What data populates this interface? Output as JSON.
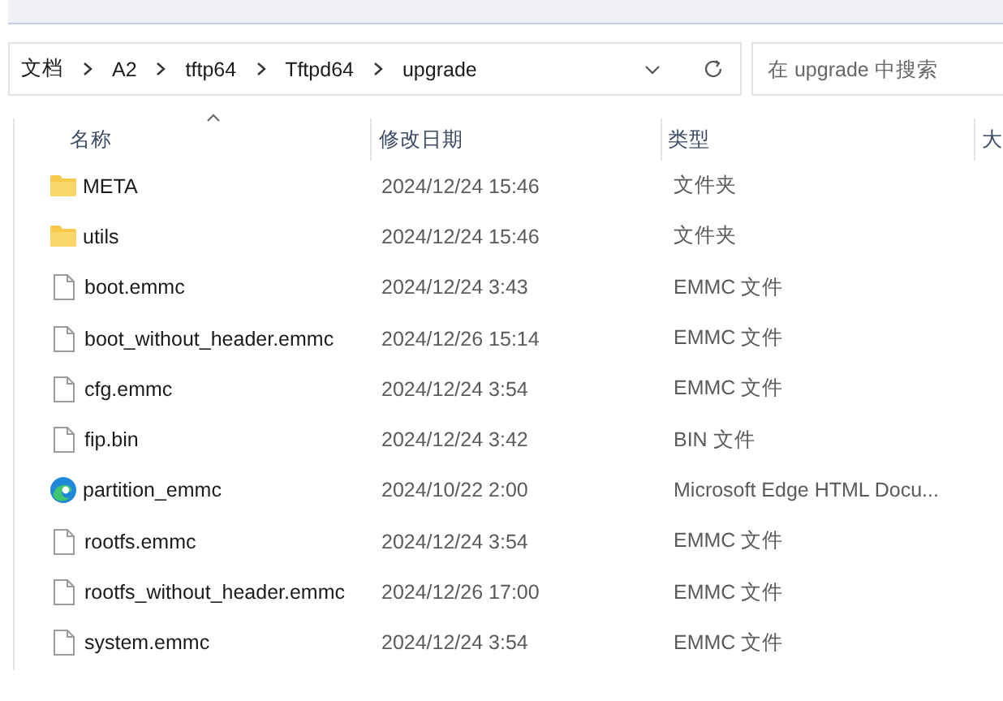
{
  "address_bar": {
    "path": [
      "文档",
      "A2",
      "tftp64",
      "Tftpd64",
      "upgrade"
    ]
  },
  "search": {
    "placeholder": "在 upgrade 中搜索"
  },
  "table": {
    "columns": [
      {
        "label": "名称",
        "sorted": true
      },
      {
        "label": "修改日期",
        "sorted": false
      },
      {
        "label": "类型",
        "sorted": false
      },
      {
        "label": "大",
        "sorted": false
      }
    ],
    "rows": [
      {
        "kind": "folder",
        "name": "META",
        "date": "2024/12/24 15:46",
        "type": "文件夹"
      },
      {
        "kind": "folder",
        "name": "utils",
        "date": "2024/12/24 15:46",
        "type": "文件夹"
      },
      {
        "kind": "file",
        "name": "boot.emmc",
        "date": "2024/12/24 3:43",
        "type": "EMMC 文件"
      },
      {
        "kind": "file",
        "name": "boot_without_header.emmc",
        "date": "2024/12/26 15:14",
        "type": "EMMC 文件"
      },
      {
        "kind": "file",
        "name": "cfg.emmc",
        "date": "2024/12/24 3:54",
        "type": "EMMC 文件"
      },
      {
        "kind": "file",
        "name": "fip.bin",
        "date": "2024/12/24 3:42",
        "type": "BIN 文件"
      },
      {
        "kind": "edge",
        "name": "partition_emmc",
        "date": "2024/10/22 2:00",
        "type": "Microsoft Edge HTML Docu..."
      },
      {
        "kind": "file",
        "name": "rootfs.emmc",
        "date": "2024/12/24 3:54",
        "type": "EMMC 文件"
      },
      {
        "kind": "file",
        "name": "rootfs_without_header.emmc",
        "date": "2024/12/26 17:00",
        "type": "EMMC 文件"
      },
      {
        "kind": "file",
        "name": "system.emmc",
        "date": "2024/12/24 3:54",
        "type": "EMMC 文件"
      }
    ]
  }
}
